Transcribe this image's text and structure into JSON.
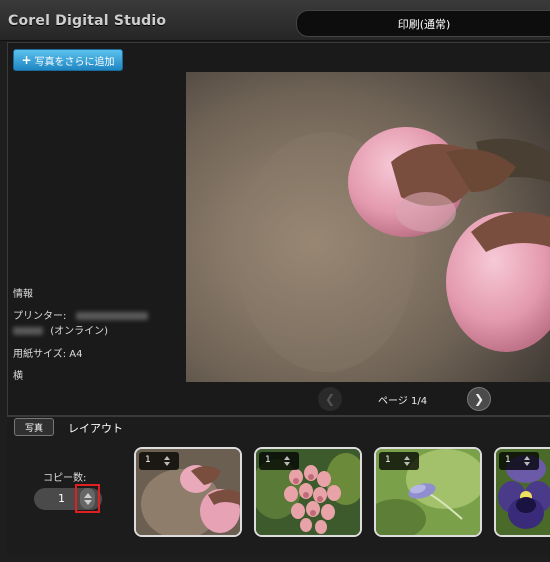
{
  "app": {
    "title": "Corel Digital Studio"
  },
  "header": {
    "mode_tab": "印刷(通常)"
  },
  "toolbar": {
    "add_photos_label": "写真をさらに追加"
  },
  "info": {
    "heading": "情報",
    "printer_label": "プリンター:",
    "printer_status": "(オンライン)",
    "paper_size": "用紙サイズ: A4",
    "orientation": "横"
  },
  "preview": {
    "page_label": "ページ 1/4"
  },
  "tabs": {
    "photo": "写真",
    "layout": "レイアウト"
  },
  "copies": {
    "label": "コピー数:",
    "value": "1"
  },
  "thumbnails": [
    {
      "count": "1",
      "subject": "peach-blossom-buds"
    },
    {
      "count": "1",
      "subject": "pink-bell-flowers"
    },
    {
      "count": "1",
      "subject": "purple-crocus-bud"
    },
    {
      "count": "1",
      "subject": "purple-pansy"
    }
  ],
  "colors": {
    "accent": "#2a9ad8",
    "highlight_box": "#e02020",
    "background": "#1e1e1e"
  }
}
